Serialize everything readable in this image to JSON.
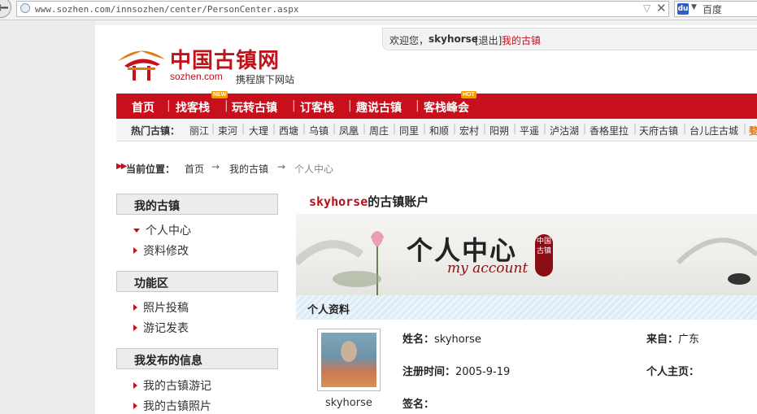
{
  "browser": {
    "url": "www.sozhen.com/innsozhen/center/PersonCenter.aspx",
    "search_engine": "百度",
    "search_icon_text": "du"
  },
  "site": {
    "logo_title": "中国古镇网",
    "logo_domain": "sozhen.com",
    "logo_slogan": "携程旗下网站",
    "brand_color": "#c8101c"
  },
  "welcome": {
    "greeting": "欢迎您，",
    "username": "skyhorse",
    "logout": "[退出]",
    "my_town": "我的古镇"
  },
  "nav": {
    "items": [
      {
        "label": "首页",
        "badge": ""
      },
      {
        "label": "找客栈",
        "badge": "NEW"
      },
      {
        "label": "玩转古镇",
        "badge": ""
      },
      {
        "label": "订客栈",
        "badge": ""
      },
      {
        "label": "趣说古镇",
        "badge": ""
      },
      {
        "label": "客栈峰会",
        "badge": "HOT"
      }
    ]
  },
  "hot_towns": {
    "label": "热门古镇：",
    "towns": [
      "丽江",
      "束河",
      "大理",
      "西塘",
      "乌镇",
      "凤凰",
      "周庄",
      "同里",
      "和顺",
      "宏村",
      "阳朔",
      "平遥",
      "泸沽湖",
      "香格里拉",
      "天府古镇",
      "台儿庄古城",
      "婺"
    ]
  },
  "breadcrumb": {
    "arrows": "▶▶",
    "label": "当前位置：",
    "home": "首页",
    "sep": "→",
    "parent": "我的古镇",
    "current": "个人中心"
  },
  "sidebar": {
    "sections": [
      {
        "title": "我的古镇",
        "items": [
          "个人中心",
          "资料修改"
        ]
      },
      {
        "title": "功能区",
        "items": [
          "照片投稿",
          "游记发表"
        ]
      },
      {
        "title": "我发布的信息",
        "items": [
          "我的古镇游记",
          "我的古镇照片"
        ]
      }
    ]
  },
  "main": {
    "account_user": "skyhorse",
    "account_suffix": "的古镇账户",
    "banner_title": "个人中心",
    "banner_sub": "my account",
    "banner_seal": "中国古镇",
    "profile_header": "个人资料",
    "avatar_name": "skyhorse",
    "fields": {
      "name_label": "姓名：",
      "name_value": "skyhorse",
      "from_label": "来自：",
      "from_value": "广东",
      "reg_label": "注册时间：",
      "reg_value": "2005-9-19",
      "homepage_label": "个人主页：",
      "homepage_value": "",
      "sign_label": "签名：",
      "sign_value": ""
    }
  }
}
